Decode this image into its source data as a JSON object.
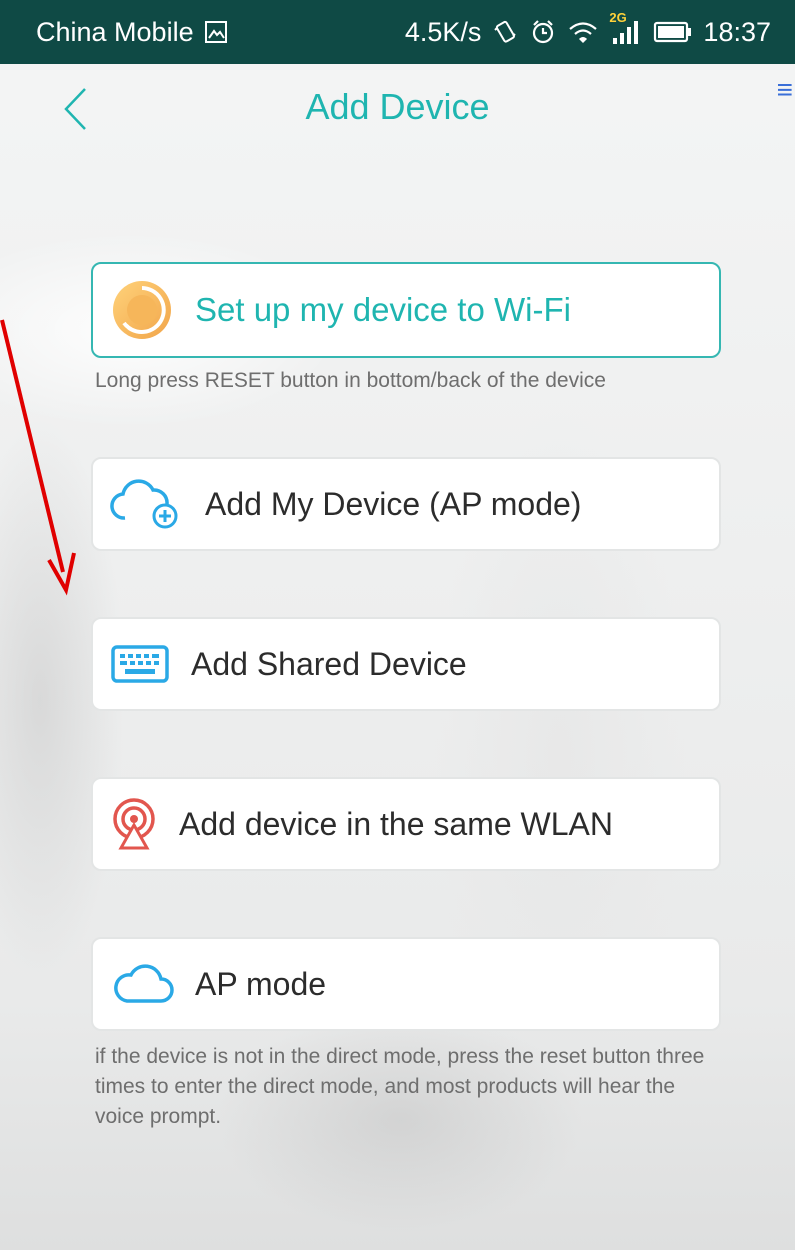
{
  "status_bar": {
    "carrier": "China Mobile",
    "network_speed": "4.5K/s",
    "network_type": "2G",
    "time": "18:37"
  },
  "header": {
    "title": "Add Device",
    "back_icon": "chevron-left-icon"
  },
  "options": [
    {
      "label": "Set up my device to Wi-Fi",
      "icon": "wifi-setup-icon",
      "hint": "Long press RESET button in bottom/back of the device"
    },
    {
      "label": "Add My Device (AP mode)",
      "icon": "cloud-add-icon"
    },
    {
      "label": "Add Shared Device",
      "icon": "keyboard-icon"
    },
    {
      "label": "Add device in the same WLAN",
      "icon": "broadcast-icon"
    },
    {
      "label": "AP mode",
      "icon": "cloud-icon",
      "hint": "if the device is not in the direct mode, press the reset button three times to enter the direct mode, and most products will hear the voice prompt."
    }
  ],
  "colors": {
    "accent": "#1fb5b0",
    "status_bar": "#0f4a45",
    "annotation_arrow": "#e00000",
    "wlan_icon": "#e2564e",
    "cloud_icon": "#2aa9e6"
  }
}
